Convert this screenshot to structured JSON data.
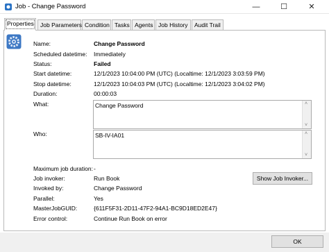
{
  "window": {
    "title": "Job - Change Password",
    "minimize": "—",
    "maximize": "☐",
    "close": "✕"
  },
  "tabs": [
    {
      "label": "Properties",
      "active": true
    },
    {
      "label": "Job Parameters",
      "active": false
    },
    {
      "label": "Condition",
      "active": false
    },
    {
      "label": "Tasks",
      "active": false
    },
    {
      "label": "Agents",
      "active": false
    },
    {
      "label": "Job History",
      "active": false
    },
    {
      "label": "Audit Trail",
      "active": false
    }
  ],
  "properties": {
    "name_label": "Name:",
    "name_value": "Change Password",
    "scheduled_label": "Scheduled datetime:",
    "scheduled_value": "Immediately",
    "status_label": "Status:",
    "status_value": "Failed",
    "start_label": "Start datetime:",
    "start_value": "12/1/2023 10:04:00 PM (UTC)  (Localtime: 12/1/2023 3:03:59 PM)",
    "stop_label": "Stop datetime:",
    "stop_value": "12/1/2023 10:04:03 PM (UTC)  (Localtime: 12/1/2023 3:04:02 PM)",
    "duration_label": "Duration:",
    "duration_value": "00:00:03",
    "what_label": "What:",
    "what_value": "Change Password",
    "who_label": "Who:",
    "who_value": "SB-IV-IA01",
    "max_duration_label": "Maximum job duration:",
    "max_duration_value": "-",
    "invoker_label": "Job invoker:",
    "invoker_value": "Run Book",
    "invoked_by_label": "Invoked by:",
    "invoked_by_value": "Change Password",
    "parallel_label": "Parallel:",
    "parallel_value": "Yes",
    "master_guid_label": "MasterJobGUID:",
    "master_guid_value": "{611F5F31-2D11-47F2-94A1-BC9D18ED2E47}",
    "error_label": "Error control:",
    "error_value": "Continue Run Book on error"
  },
  "buttons": {
    "show_invoker": "Show Job Invoker...",
    "ok": "OK"
  },
  "scroll": {
    "up": "˄",
    "down": "˅"
  },
  "icons": {
    "app": "job-icon",
    "properties": "gear-icon"
  }
}
